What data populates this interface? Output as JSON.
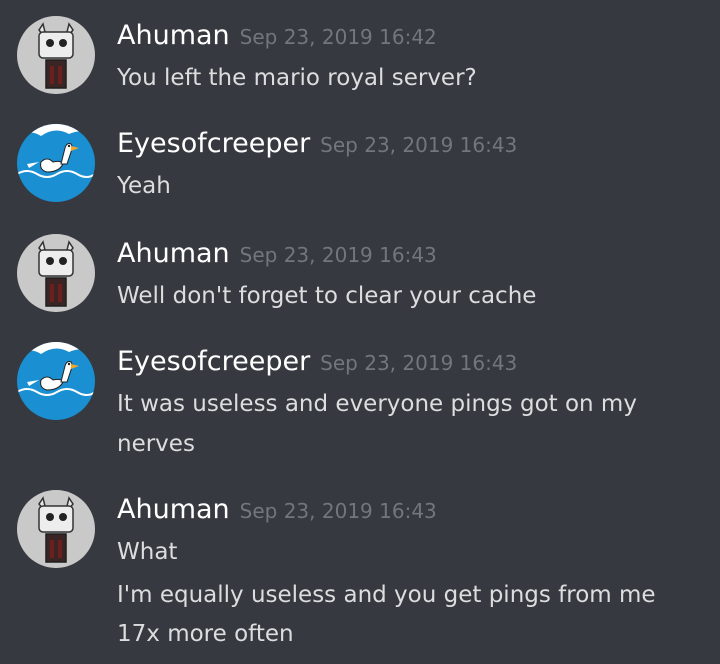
{
  "messages": [
    {
      "author": "Ahuman",
      "avatar": "cat-robot-avatar",
      "timestamp": "Sep 23, 2019 16:42",
      "lines": [
        "You left the mario royal server?"
      ]
    },
    {
      "author": "Eyesofcreeper",
      "avatar": "goose-avatar",
      "timestamp": "Sep 23, 2019 16:43",
      "lines": [
        "Yeah"
      ]
    },
    {
      "author": "Ahuman",
      "avatar": "cat-robot-avatar",
      "timestamp": "Sep 23, 2019 16:43",
      "lines": [
        "Well don't forget to clear your cache"
      ]
    },
    {
      "author": "Eyesofcreeper",
      "avatar": "goose-avatar",
      "timestamp": "Sep 23, 2019 16:43",
      "lines": [
        "It was useless and everyone pings got on my",
        "nerves"
      ]
    },
    {
      "author": "Ahuman",
      "avatar": "cat-robot-avatar",
      "timestamp": "Sep 23, 2019 16:43",
      "lines": [
        "What",
        "I'm equally useless and you get pings from me",
        "17x more often"
      ]
    }
  ],
  "colors": {
    "background": "#36393f",
    "username": "#ffffff",
    "timestamp": "#72767d",
    "message_text": "#dcddde"
  }
}
